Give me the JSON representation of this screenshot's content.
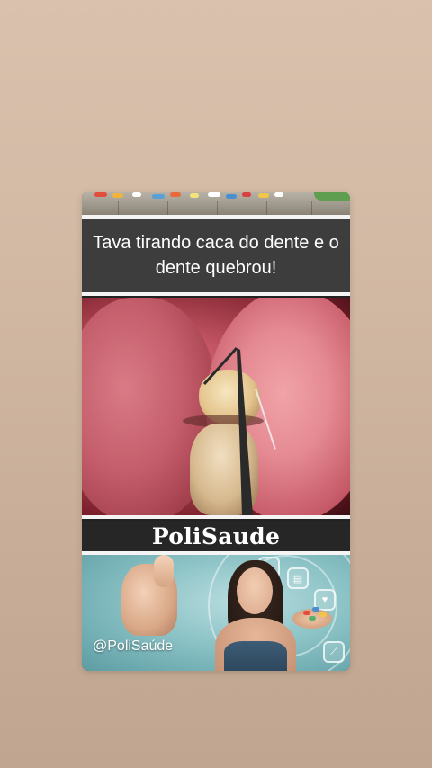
{
  "story": {
    "headline": "Tava tirando caca do dente e o dente quebrou!",
    "brand": "PoliSaude",
    "handle": "@PoliSaúde"
  },
  "images": {
    "top_strip": "pills-on-wooden-table",
    "main_photo": "close-up-of-tooth-with-dental-probe",
    "promo": "woman-smiling-with-thumbs-up-and-medicine-icons"
  },
  "colors": {
    "background": "#d2b9a4",
    "headline_bg": "#3d3d3d",
    "brand_bg": "#262626",
    "text": "#ffffff"
  }
}
